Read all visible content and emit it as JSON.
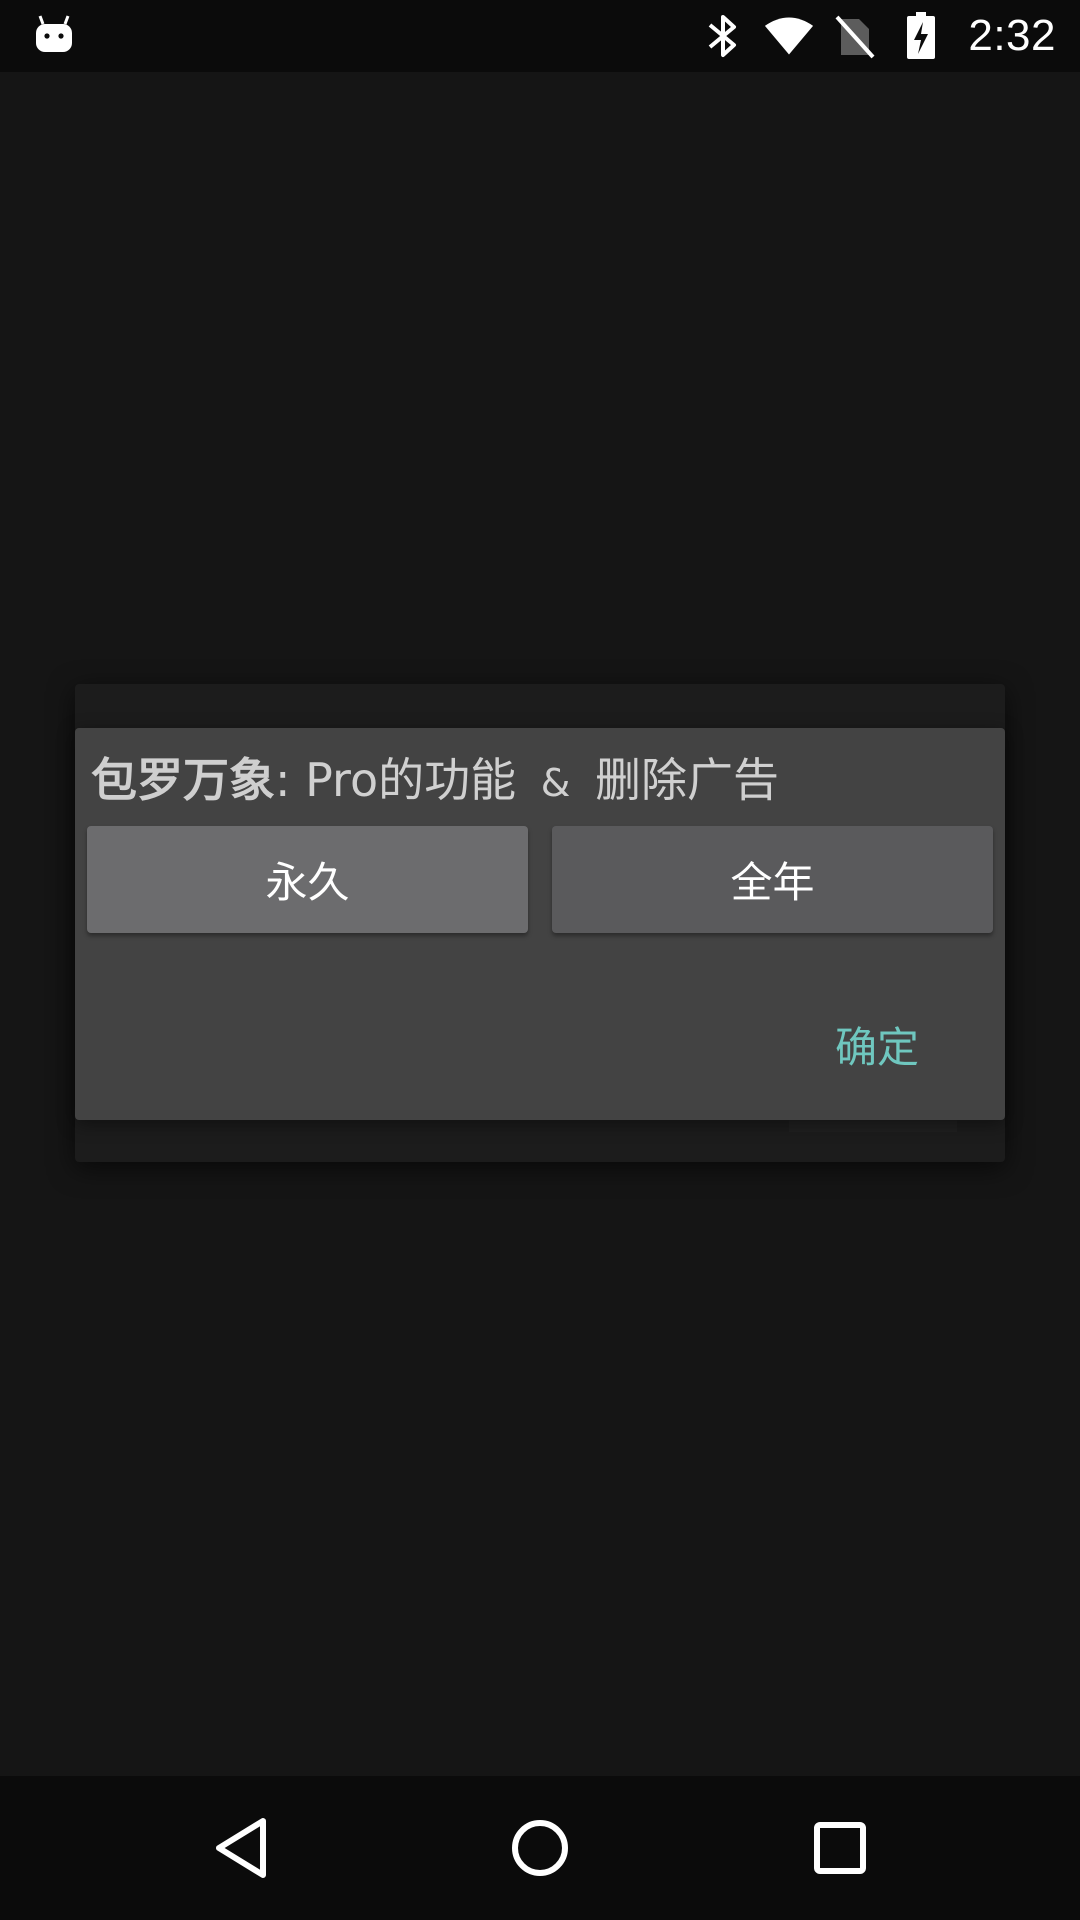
{
  "status_bar": {
    "time": "2:32",
    "icons": [
      "android-icon",
      "bluetooth-icon",
      "wifi-icon",
      "no-sim-icon",
      "battery-charging-icon"
    ]
  },
  "dialog": {
    "title_app_name": "包罗万象",
    "title_rest": ": Pro的功能",
    "title_amp": "&",
    "title_end": "删除广告",
    "options": [
      {
        "label": "永久"
      },
      {
        "label": "全年"
      }
    ],
    "confirm_label": "确定",
    "accent_color": "#6fc7bf"
  },
  "nav_bar": {
    "icons": [
      "back-icon",
      "home-icon",
      "recents-icon"
    ]
  }
}
